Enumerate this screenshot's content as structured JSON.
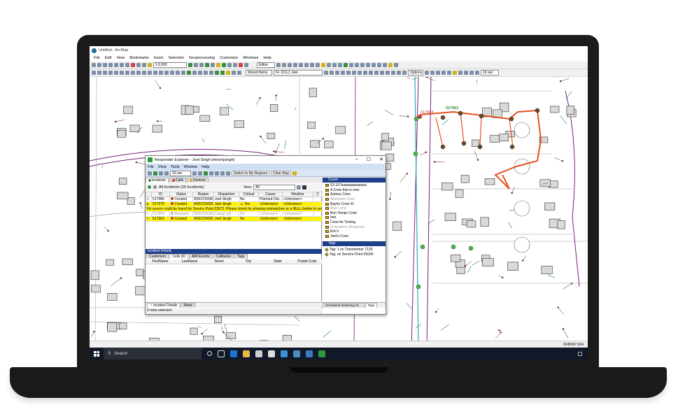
{
  "window_title": "Untitled - ArcMap",
  "menu": [
    "File",
    "Edit",
    "View",
    "Bookmarks",
    "Insert",
    "Selection",
    "Geoprocessing",
    "Customize",
    "Windows",
    "Help"
  ],
  "toolbar": {
    "scale": "1:2,000",
    "editor": "Editor",
    "stored_items": "Stored Items",
    "feeder": "Fx 10.6.1 Jeet",
    "options": "Options",
    "refresh_interval": "10 sec"
  },
  "map": {
    "labels": [
      "517961",
      "517963"
    ],
    "coord": "2645997.634"
  },
  "taskbar": {
    "search_placeholder": "Search"
  },
  "responder": {
    "title": "Responder Explorer - Jeet Singh [miner\\jsingh]",
    "menu": [
      "File",
      "View",
      "Tools",
      "Window",
      "Help"
    ],
    "refresh": "10 sec",
    "switch_regions": "Switch to My Regions",
    "clear_map": "Clear Map",
    "tabs": [
      "Incidents",
      "Calls",
      "Devices"
    ],
    "all_incidents": "All Incidents (25 Incidents)",
    "view_label": "View:",
    "view_value": "All",
    "columns": [
      "",
      "ID",
      "Status",
      "Region",
      "Dispatcher",
      "Critical",
      "Cause",
      "Weather",
      "C"
    ],
    "rows": [
      [
        "",
        "517986",
        "Created",
        "WISCONSIN",
        "Jeet Singh",
        "No",
        "Planned Out...",
        "<Unknown>",
        ""
      ],
      [
        "",
        "517979",
        "Created",
        "WISCONSIN",
        "Jeet Singh",
        "Yes",
        "<Unknown>",
        "<Unknown>",
        ""
      ],
      [
        "",
        "517964",
        "Restored",
        "WISCONSIN",
        "Canap QA",
        "No",
        "<Unknown>",
        "<Unknown>",
        ""
      ],
      [
        "",
        "517963",
        "Created",
        "WISCONSIN",
        "Jeet Singh",
        "No",
        "<Unknown>",
        "<Unknown>",
        ""
      ]
    ],
    "warning": "No source could be found for Service Point 22672. Please check for phasing mismatches or a NULL feeder to service",
    "details_header": "Incident Details",
    "detail_tabs": [
      "Customers",
      "Calls (0)",
      "AMI Events",
      "Callbacks",
      "Tags"
    ],
    "detail_columns": [
      "FirstName",
      "LastName",
      "Street",
      "City",
      "State",
      "Postal Code"
    ],
    "bottom_tabs": [
      "Incident Details",
      "Alerts"
    ],
    "rows_selected": "0 rows selected.",
    "crews_header": "Crews",
    "crews": [
      {
        "name": "52-167aaaaaaaaaaaaa",
        "active": true
      },
      {
        "name": "A Crew that is new",
        "active": true
      },
      {
        "name": "Aubrey Crew",
        "active": true
      },
      {
        "name": "Awesome Crew",
        "active": false
      },
      {
        "name": "Baylor Crew #1",
        "active": true
      },
      {
        "name": "Blue Crew",
        "active": false
      },
      {
        "name": "Bon Temps Crew",
        "active": true
      },
      {
        "name": "boo",
        "active": true
      },
      {
        "name": "Crew for Testing",
        "active": true
      },
      {
        "name": "Emergency Response",
        "active": false
      },
      {
        "name": "Eric's",
        "active": true
      },
      {
        "name": "Jeet's Crew",
        "active": true
      }
    ],
    "tags_header": "Tags",
    "tags": [
      "Tag: 1 on Transformer 7133",
      "Tag: on Service Point 25035"
    ],
    "right_tabs": [
      "Scheduled Switching Or...",
      "Tags"
    ]
  },
  "colors": {
    "selected_row": "#fff200",
    "panel_header": "#1e3f8c",
    "trace": "#e2531f",
    "road": "#7a1f7a",
    "feeder": "#2aa8b8"
  }
}
